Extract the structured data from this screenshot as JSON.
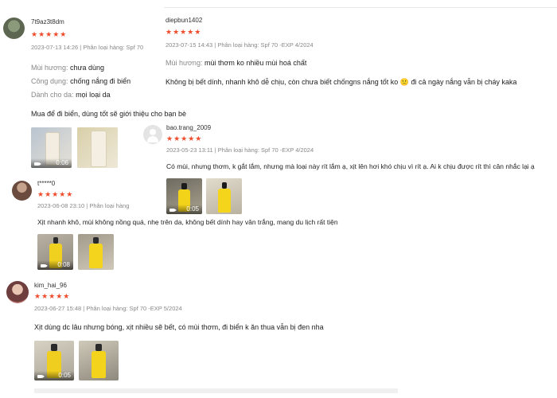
{
  "reviews": [
    {
      "username": "7t9az3t8dm",
      "stars": "★★★★★",
      "meta": "2023-07-13 14:26 | Phân loại hàng: Spf 70",
      "attrs": [
        {
          "label": "Mùi hương:",
          "value": "chưa dùng"
        },
        {
          "label": "Công dụng:",
          "value": "chống nắng đi biển"
        },
        {
          "label": "Dành cho da:",
          "value": "mọi loại da"
        }
      ],
      "text": "Mua để đi biển, dùng tốt sẽ giới thiệu cho bạn bè",
      "media": [
        {
          "duration": "0:06"
        },
        {
          "duration": ""
        }
      ]
    },
    {
      "username": "diepbun1402",
      "stars": "★★★★★",
      "meta": "2023-07-15 14:43 | Phân loại hàng: Spf 70 -EXP 4/2024",
      "attrs": [
        {
          "label": "Mùi hương:",
          "value": "mùi thơm ko nhiều mùi hoá chất"
        }
      ],
      "text": "Không bị bết dính, nhanh khô dễ chịu, còn chưa biết chốngns nắng tốt ko 🙁 đi cả ngày nắng vẫn bị cháy kaka",
      "media": []
    },
    {
      "username": "bao.trang_2009",
      "stars": "★★★★★",
      "meta": "2023-05-23 13:11 | Phân loại hàng: Spf 70 -EXP 4/2024",
      "attrs": [],
      "text": "Có mùi, nhưng thơm, k gắt lắm, nhưng mà loại này rít lắm ạ, xịt lên hơi khó chịu vì rít ạ. Ai k chịu được rít thì cân nhắc lại ạ",
      "media": [
        {
          "duration": "0:05"
        },
        {
          "duration": ""
        }
      ]
    },
    {
      "username": "t*****0",
      "stars": "★★★★★",
      "meta": "2023-06-08 23:10 | Phân loại hàng",
      "attrs": [],
      "text": "Xịt nhanh khô, mùi không nồng quá, nhẹ trên da, không bết dính hay vân trắng, mang du lịch rất tiện",
      "media": [
        {
          "duration": "0:08"
        },
        {
          "duration": ""
        }
      ]
    },
    {
      "username": "kim_hai_96",
      "stars": "★★★★★",
      "meta": "2023-06-27 15:48 | Phân loại hàng: Spf 70 -EXP 5/2024",
      "attrs": [],
      "text": "Xịt dùng dc lâu nhưng bóng, xịt nhiều sẽ bết, có mùi thơm, đi biển k ăn thua vẫn bị đen nha",
      "media": [
        {
          "duration": "0:05"
        },
        {
          "duration": ""
        }
      ]
    }
  ],
  "colors": {
    "star": "#ee4d2d",
    "muted": "#888888",
    "text": "#222222"
  }
}
